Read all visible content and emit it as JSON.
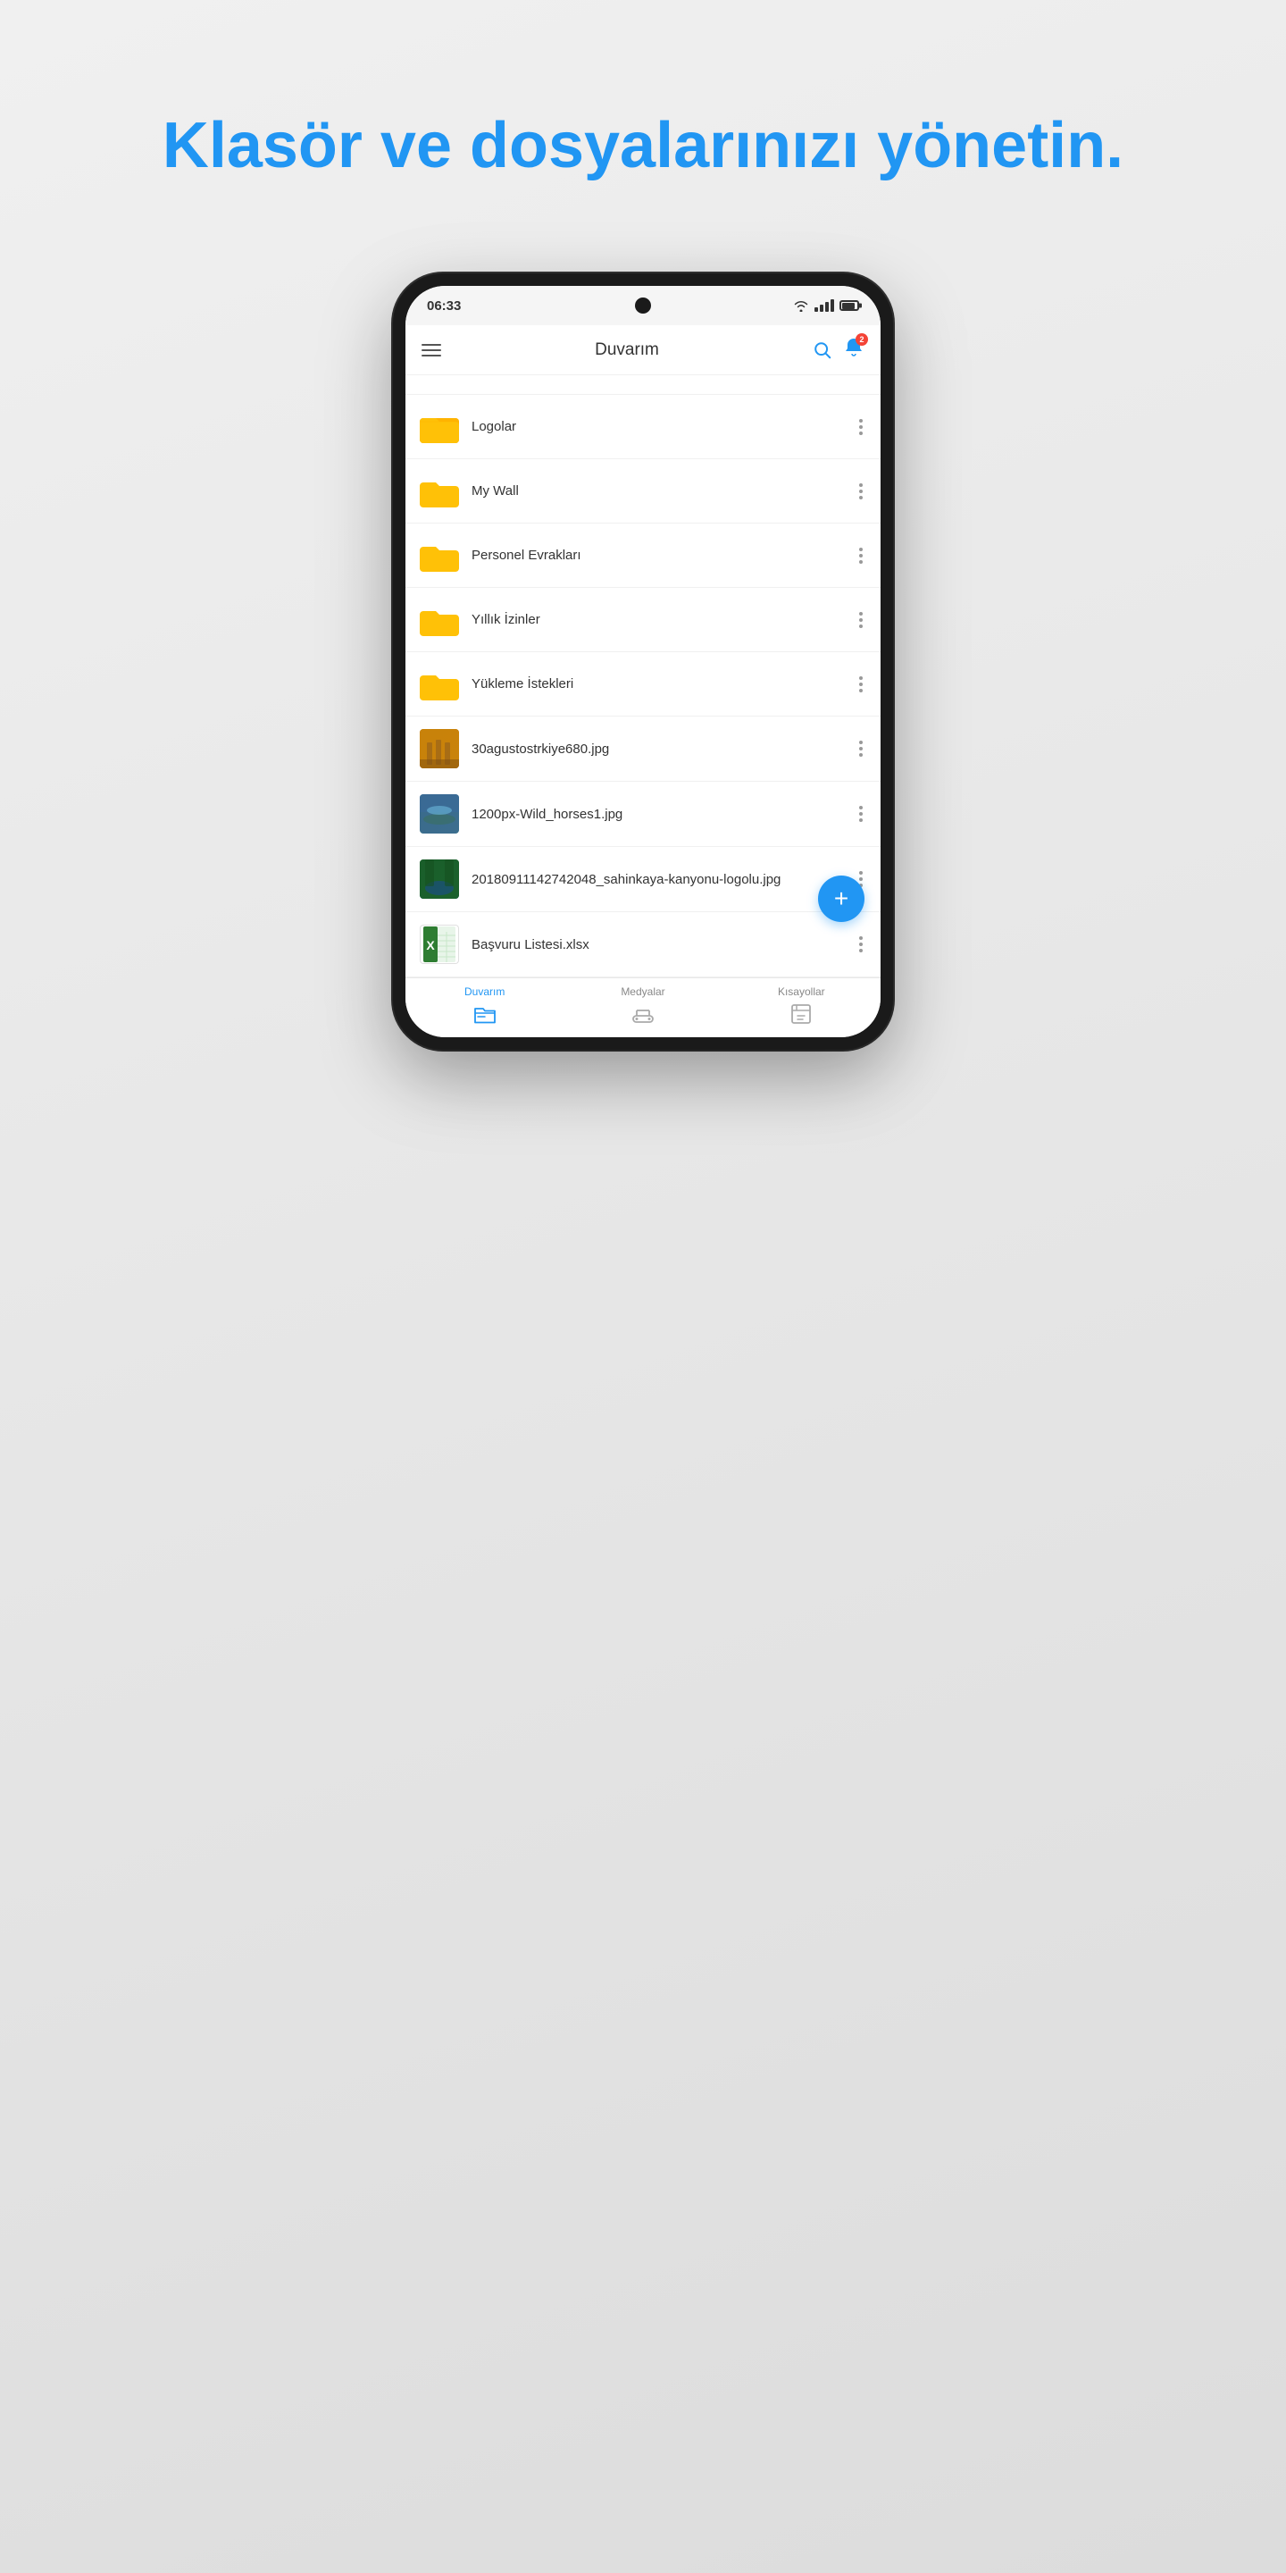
{
  "headline": "Klasör ve dosyalarınızı yönetin.",
  "status_bar": {
    "time": "06:33",
    "battery_badge": ""
  },
  "app_header": {
    "title": "Duvarım",
    "bell_badge": "2"
  },
  "file_items": [
    {
      "type": "folder",
      "name": "Logolar"
    },
    {
      "type": "folder",
      "name": "My Wall"
    },
    {
      "type": "folder",
      "name": "Personel Evrakları"
    },
    {
      "type": "folder",
      "name": "Yıllık İzinler"
    },
    {
      "type": "folder",
      "name": "Yükleme İstekleri"
    },
    {
      "type": "image1",
      "name": "30agustostrkiye680.jpg"
    },
    {
      "type": "image2",
      "name": "1200px-Wild_horses1.jpg"
    },
    {
      "type": "image3",
      "name": "20180911142742048_sahinkaya-kanyonu-logolu.jpg"
    },
    {
      "type": "xlsx",
      "name": "Başvuru Listesi.xlsx"
    }
  ],
  "bottom_nav": [
    {
      "label": "Duvarım",
      "active": true
    },
    {
      "label": "Medyalar",
      "active": false
    },
    {
      "label": "Kısayollar",
      "active": false
    }
  ],
  "fab_label": "+"
}
